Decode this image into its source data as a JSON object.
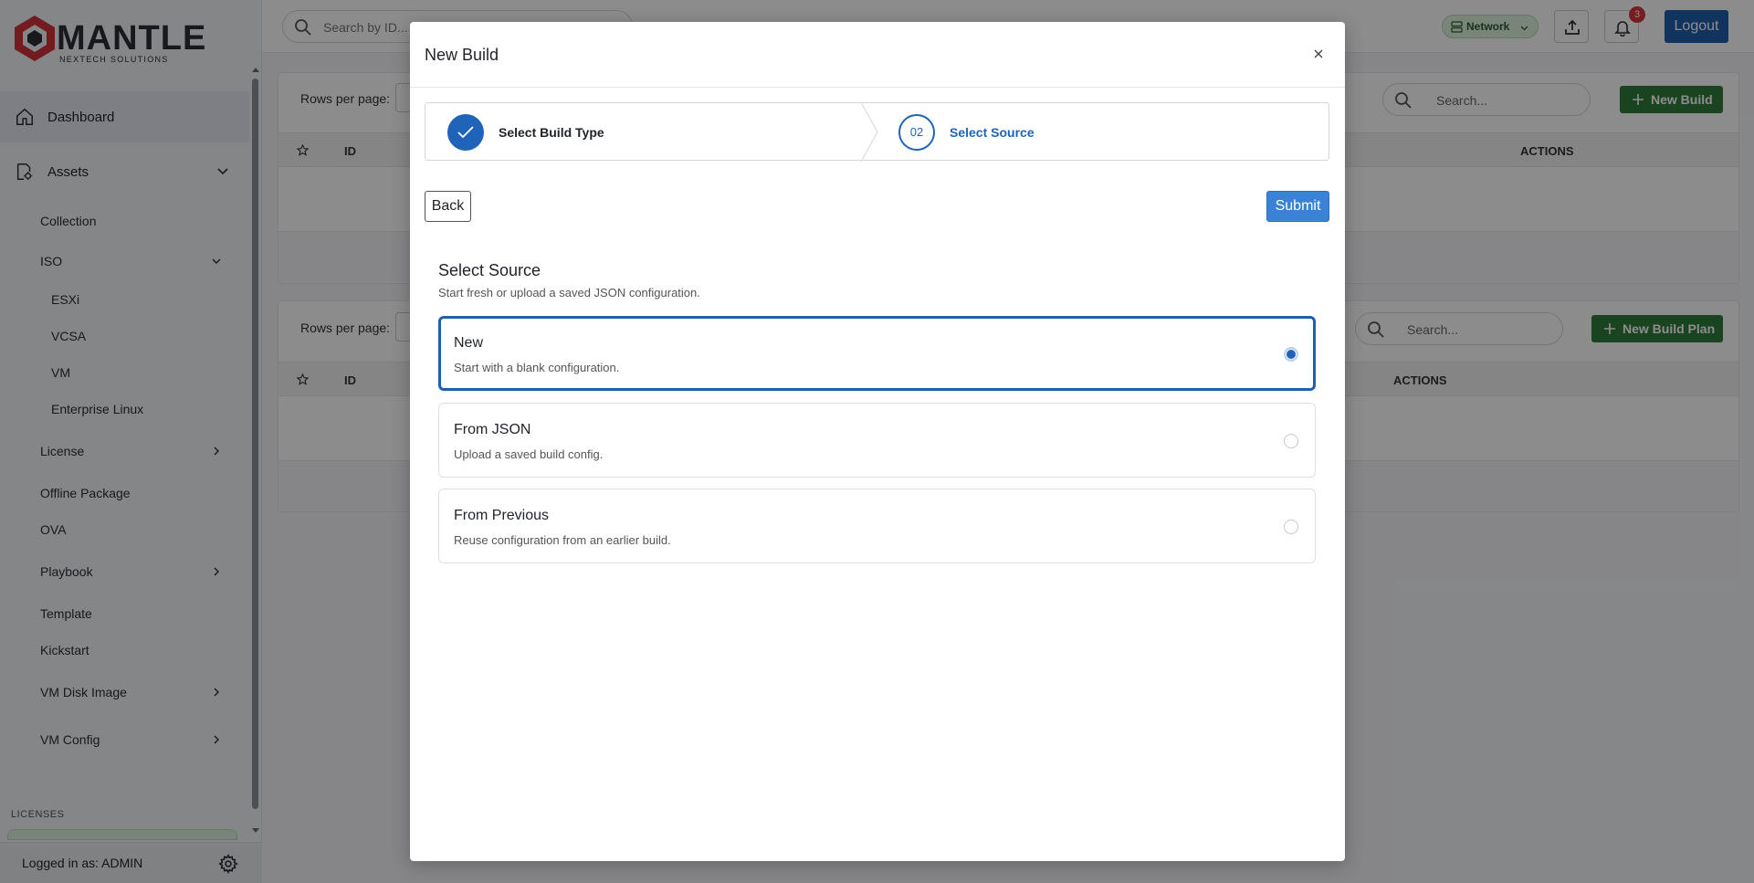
{
  "brand": {
    "name": "MANTLE",
    "tagline": "NEXTECH SOLUTIONS",
    "color": "#d1343b"
  },
  "sidebar": {
    "items": [
      {
        "label": "Dashboard",
        "icon": "home-icon",
        "active": true
      },
      {
        "label": "Assets",
        "icon": "assets-icon",
        "expanded": true
      }
    ],
    "assets_children": [
      {
        "label": "Collection"
      },
      {
        "label": "ISO",
        "expanded": true
      },
      {
        "label": "ESXi"
      },
      {
        "label": "VCSA"
      },
      {
        "label": "VM"
      },
      {
        "label": "Enterprise Linux"
      },
      {
        "label": "License"
      },
      {
        "label": "Offline Package"
      },
      {
        "label": "OVA"
      },
      {
        "label": "Playbook"
      },
      {
        "label": "Template"
      },
      {
        "label": "Kickstart"
      },
      {
        "label": "VM Disk Image"
      },
      {
        "label": "VM Config"
      }
    ],
    "licenses_heading": "LICENSES",
    "footer_text": "Logged in as: ADMIN"
  },
  "topbar": {
    "search_placeholder": "Search by ID...",
    "network_label": "Network",
    "notification_count": "3",
    "logout_label": "Logout"
  },
  "builds_panel": {
    "rows_per_page_label": "Rows per page:",
    "search_placeholder": "Search...",
    "new_button": "New Build",
    "col_id": "ID",
    "col_actions": "ACTIONS"
  },
  "plans_panel": {
    "rows_per_page_label": "Rows per page:",
    "search_placeholder": "Search...",
    "new_button": "New Build Plan",
    "col_id": "ID",
    "col_actions": "ACTIONS"
  },
  "modal": {
    "title": "New Build",
    "steps": [
      {
        "label": "Select Build Type",
        "status": "complete"
      },
      {
        "number": "02",
        "label": "Select Source",
        "status": "current"
      }
    ],
    "back_label": "Back",
    "submit_label": "Submit",
    "section_title": "Select Source",
    "section_subtitle": "Start fresh or upload a saved JSON configuration.",
    "options": [
      {
        "title": "New",
        "desc": "Start with a blank configuration.",
        "selected": true
      },
      {
        "title": "From JSON",
        "desc": "Upload a saved build config.",
        "selected": false
      },
      {
        "title": "From Previous",
        "desc": "Reuse configuration from an earlier build.",
        "selected": false
      }
    ],
    "accent_color": "#1f64b8"
  }
}
